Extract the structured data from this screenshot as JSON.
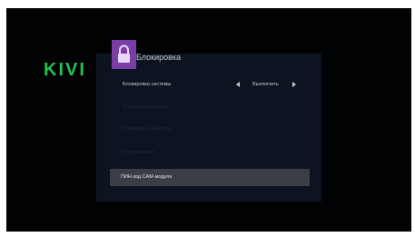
{
  "brand": {
    "logo_text": "KIVI",
    "accent": "#26c24a"
  },
  "menu": {
    "title": "Блокировка",
    "icon": "lock-icon",
    "icon_tile_color": "#7a3fa6",
    "items": [
      {
        "label": "Блокировка системы",
        "value": "Выключить",
        "state": "enabled"
      },
      {
        "label": "Установить пароль",
        "state": "disabled"
      },
      {
        "label": "Блокировка каналов",
        "state": "disabled"
      },
      {
        "label": "Родительский",
        "state": "disabled"
      },
      {
        "label": "ПИН код CAM-модуля",
        "state": "selected"
      }
    ]
  }
}
